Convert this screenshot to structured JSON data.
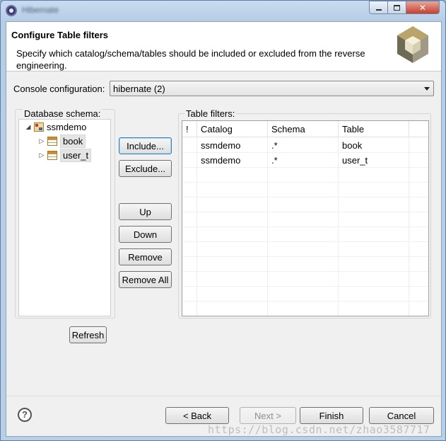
{
  "window": {
    "title": "Hibernate"
  },
  "header": {
    "title": "Configure Table filters",
    "description": "Specify which catalog/schema/tables should be included or excluded from the reverse engineering."
  },
  "console": {
    "label": "Console configuration:",
    "value": "hibernate (2)"
  },
  "schema_panel": {
    "label": "Database schema:",
    "root": "ssmdemo",
    "tables": [
      "book",
      "user_t"
    ]
  },
  "buttons": {
    "include": "Include...",
    "exclude": "Exclude...",
    "up": "Up",
    "down": "Down",
    "remove": "Remove",
    "remove_all": "Remove All",
    "refresh": "Refresh"
  },
  "filters": {
    "label": "Table filters:",
    "columns": [
      "!",
      "Catalog",
      "Schema",
      "Table"
    ],
    "rows": [
      {
        "flag": "",
        "catalog": "ssmdemo",
        "schema": ".*",
        "table": "book"
      },
      {
        "flag": "",
        "catalog": "ssmdemo",
        "schema": ".*",
        "table": "user_t"
      }
    ]
  },
  "footer": {
    "back": "< Back",
    "next": "Next >",
    "finish": "Finish",
    "cancel": "Cancel",
    "watermark": "https://blog.csdn.net/zhao3587717"
  }
}
